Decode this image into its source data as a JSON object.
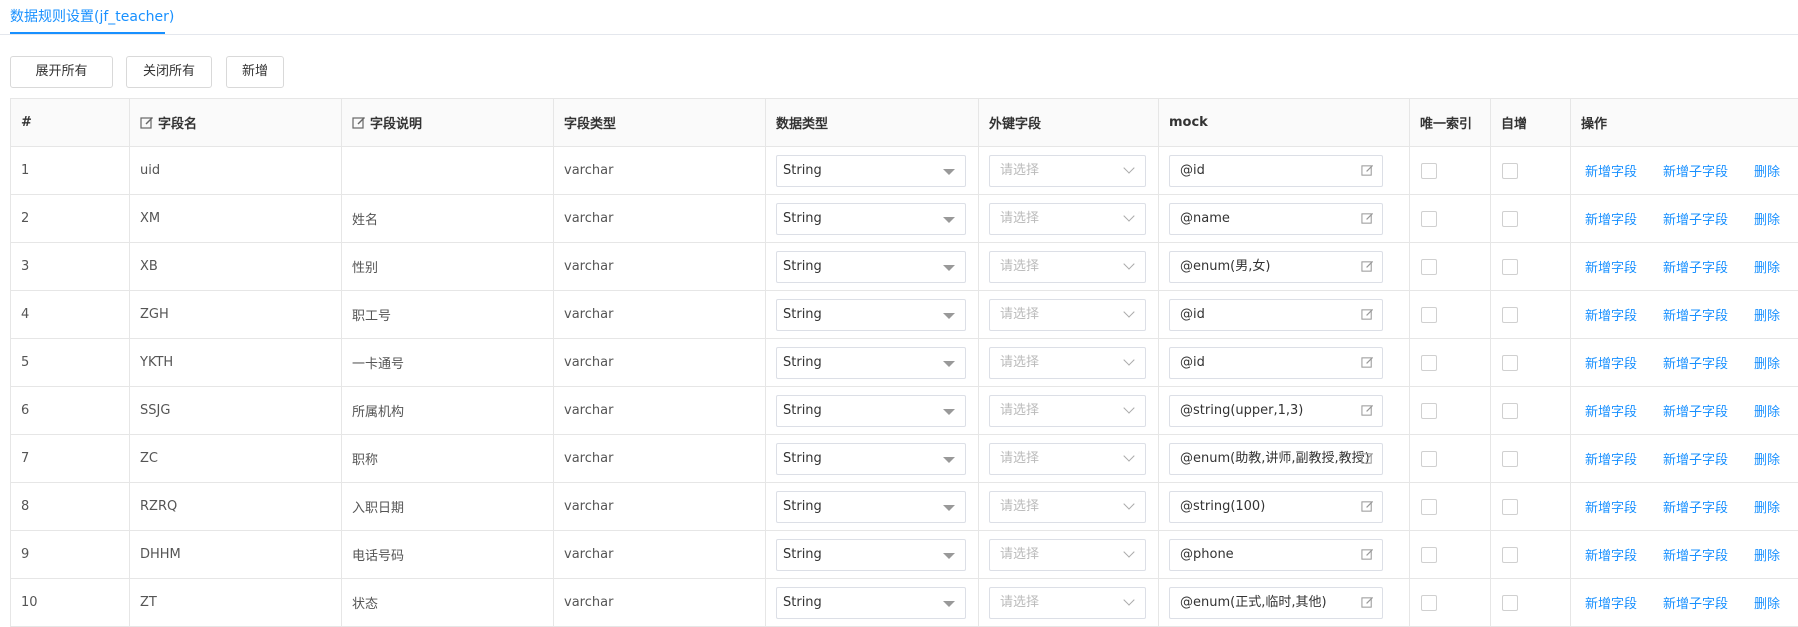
{
  "tab": {
    "title": "数据规则设置(jf_teacher)"
  },
  "toolbar": {
    "expand_all": "展开所有",
    "collapse_all": "关闭所有",
    "add": "新增"
  },
  "table": {
    "headers": {
      "index": "#",
      "field_name": "字段名",
      "field_desc": "字段说明",
      "field_type": "字段类型",
      "data_type": "数据类型",
      "foreign_key": "外键字段",
      "mock": "mock",
      "unique_index": "唯一索引",
      "auto_increment": "自增",
      "actions": "操作"
    },
    "select_placeholder": "请选择",
    "action_labels": {
      "add_field": "新增字段",
      "add_child_field": "新增子字段",
      "delete": "删除"
    },
    "rows": [
      {
        "index": "1",
        "name": "uid",
        "desc": "",
        "type": "varchar",
        "data_type": "String",
        "mock": "@id"
      },
      {
        "index": "2",
        "name": "XM",
        "desc": "姓名",
        "type": "varchar",
        "data_type": "String",
        "mock": "@name"
      },
      {
        "index": "3",
        "name": "XB",
        "desc": "性别",
        "type": "varchar",
        "data_type": "String",
        "mock": "@enum(男,女)"
      },
      {
        "index": "4",
        "name": "ZGH",
        "desc": "职工号",
        "type": "varchar",
        "data_type": "String",
        "mock": "@id"
      },
      {
        "index": "5",
        "name": "YKTH",
        "desc": "一卡通号",
        "type": "varchar",
        "data_type": "String",
        "mock": "@id"
      },
      {
        "index": "6",
        "name": "SSJG",
        "desc": "所属机构",
        "type": "varchar",
        "data_type": "String",
        "mock": "@string(upper,1,3)"
      },
      {
        "index": "7",
        "name": "ZC",
        "desc": "职称",
        "type": "varchar",
        "data_type": "String",
        "mock": "@enum(助教,讲师,副教授,教授)"
      },
      {
        "index": "8",
        "name": "RZRQ",
        "desc": "入职日期",
        "type": "varchar",
        "data_type": "String",
        "mock": "@string(100)"
      },
      {
        "index": "9",
        "name": "DHHM",
        "desc": "电话号码",
        "type": "varchar",
        "data_type": "String",
        "mock": "@phone"
      },
      {
        "index": "10",
        "name": "ZT",
        "desc": "状态",
        "type": "varchar",
        "data_type": "String",
        "mock": "@enum(正式,临时,其他)"
      }
    ]
  },
  "colors": {
    "accent": "#1890ff",
    "border": "#e6e6e6",
    "header_bg": "#fafafa",
    "placeholder": "#bbbbbb"
  },
  "icons": {
    "edit": "edit-icon",
    "dropdown": "caret-down-icon",
    "chevron": "chevron-down-icon"
  }
}
